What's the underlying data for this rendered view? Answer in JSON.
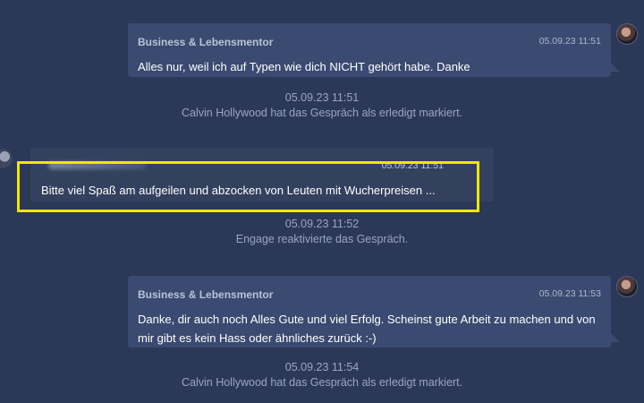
{
  "messages": [
    {
      "sender": "Business & Lebensmentor",
      "time": "05.09.23 11:51",
      "text": "Alles nur, weil ich auf Typen wie dich NICHT gehört habe. Danke"
    },
    {
      "sender": "",
      "time": "05.09.23 11:51",
      "text": "Bitte viel Spaß am aufgeilen und abzocken von Leuten mit Wucherpreisen ..."
    },
    {
      "sender": "Business & Lebensmentor",
      "time": "05.09.23 11:53",
      "text": "Danke, dir auch noch Alles Gute und viel Erfolg. Scheinst gute Arbeit zu machen und von mir gibt es kein Hass oder ähnliches zurück :-)"
    }
  ],
  "system_events": [
    {
      "time": "05.09.23 11:51",
      "text": "Calvin Hollywood hat das Gespräch als erledigt markiert."
    },
    {
      "time": "05.09.23 11:52",
      "text": "Engage reaktivierte das Gespräch."
    },
    {
      "time": "05.09.23 11:54",
      "text": "Calvin Hollywood hat das Gespräch als erledigt markiert."
    }
  ],
  "icons": {
    "agent_avatar": "avatar-icon",
    "customer_avatar": "avatar-icon"
  },
  "colors": {
    "background": "#2b3858",
    "bubble": "#3a4a70",
    "highlight": "#f2e600",
    "system_text": "#9aa6bf"
  }
}
